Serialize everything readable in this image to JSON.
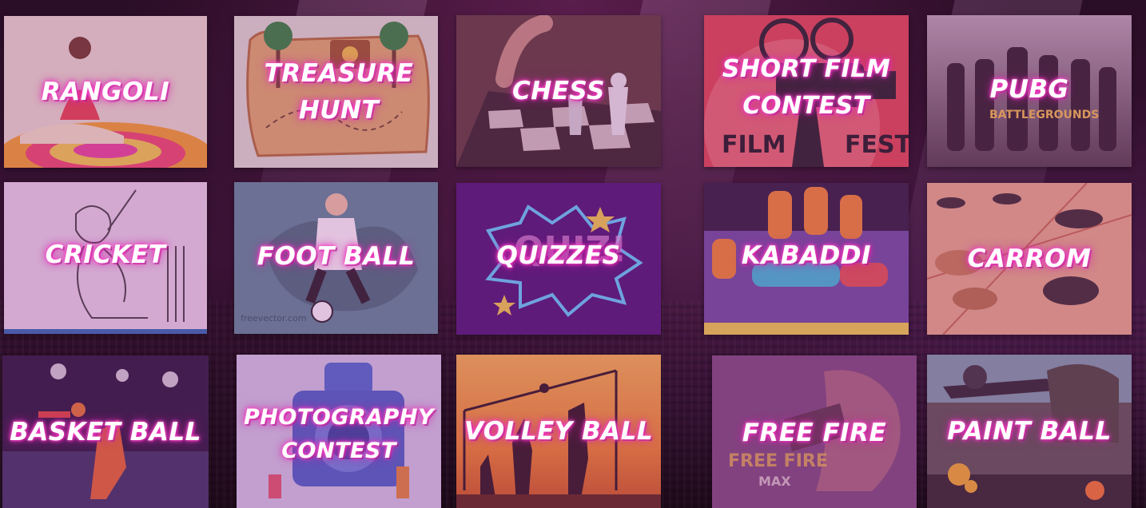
{
  "events": [
    {
      "id": "rangoli",
      "label": "RANGOLI",
      "icon": "rangoli-icon",
      "bg": "#e8dcc6",
      "accent": "#f2a13a"
    },
    {
      "id": "treasure-hunt",
      "label": "TREASURE HUNT",
      "icon": "treasure-chest-icon",
      "bg": "#c9cdb2",
      "accent": "#d9a35a"
    },
    {
      "id": "chess",
      "label": "CHESS",
      "icon": "chess-piece-icon",
      "bg": "#6e4a3c",
      "accent": "#dcdcdc"
    },
    {
      "id": "short-film-contest",
      "label": "SHORT FILM CONTEST",
      "icon": "film-projector-icon",
      "bg": "#d9434a",
      "accent": "#f2e6e0"
    },
    {
      "id": "pubg",
      "label": "PUBG",
      "icon": "soldier-icon",
      "bg": "#6b5a66",
      "accent": "#f2c14b"
    },
    {
      "id": "cricket",
      "label": "CRICKET",
      "icon": "cricket-bat-icon",
      "bg": "#e9d8ea",
      "accent": "#3a3a3a"
    },
    {
      "id": "foot-ball",
      "label": "FOOT BALL",
      "icon": "football-icon",
      "bg": "#4f7f8d",
      "accent": "#ffffff"
    },
    {
      "id": "quizzes",
      "label": "QUIZZES",
      "icon": "quiz-burst-icon",
      "bg": "#4c1a78",
      "accent": "#7ad7ff"
    },
    {
      "id": "kabaddi",
      "label": "KABADDI",
      "icon": "kabaddi-players-icon",
      "bg": "#6a4b9c",
      "accent": "#f28a2e"
    },
    {
      "id": "carrom",
      "label": "CARROM",
      "icon": "carrom-coin-icon",
      "bg": "#e2a37b",
      "accent": "#3a2f2c"
    },
    {
      "id": "basket-ball",
      "label": "BASKET BALL",
      "icon": "basketball-icon",
      "bg": "#2a1d3e",
      "accent": "#e37a2e"
    },
    {
      "id": "photography-contest",
      "label": "PHOTOGRAPHY CONTEST",
      "icon": "camera-icon",
      "bg": "#cdc6e6",
      "accent": "#4b6fd0"
    },
    {
      "id": "volley-ball",
      "label": "VOLLEY BALL",
      "icon": "volleyball-icon",
      "bg": "#f0a032",
      "accent": "#2a1a1a"
    },
    {
      "id": "free-fire",
      "label": "FREE FIRE",
      "icon": "free-fire-icon",
      "bg": "#7a4a7a",
      "accent": "#f2c14b"
    },
    {
      "id": "paint-ball",
      "label": "PAINT BALL",
      "icon": "paintball-gun-icon",
      "bg": "#5f5a52",
      "accent": "#f2b12a"
    }
  ],
  "art_text": {
    "film_left": "FILM",
    "film_right": "FESTI",
    "pubg_logo": "BATTLEGROUNDS",
    "quiz_word": "QUIZ!",
    "freevector": "freevector.com",
    "freefire_logo": "FREE FIRE",
    "freefire_sub": "MAX"
  }
}
